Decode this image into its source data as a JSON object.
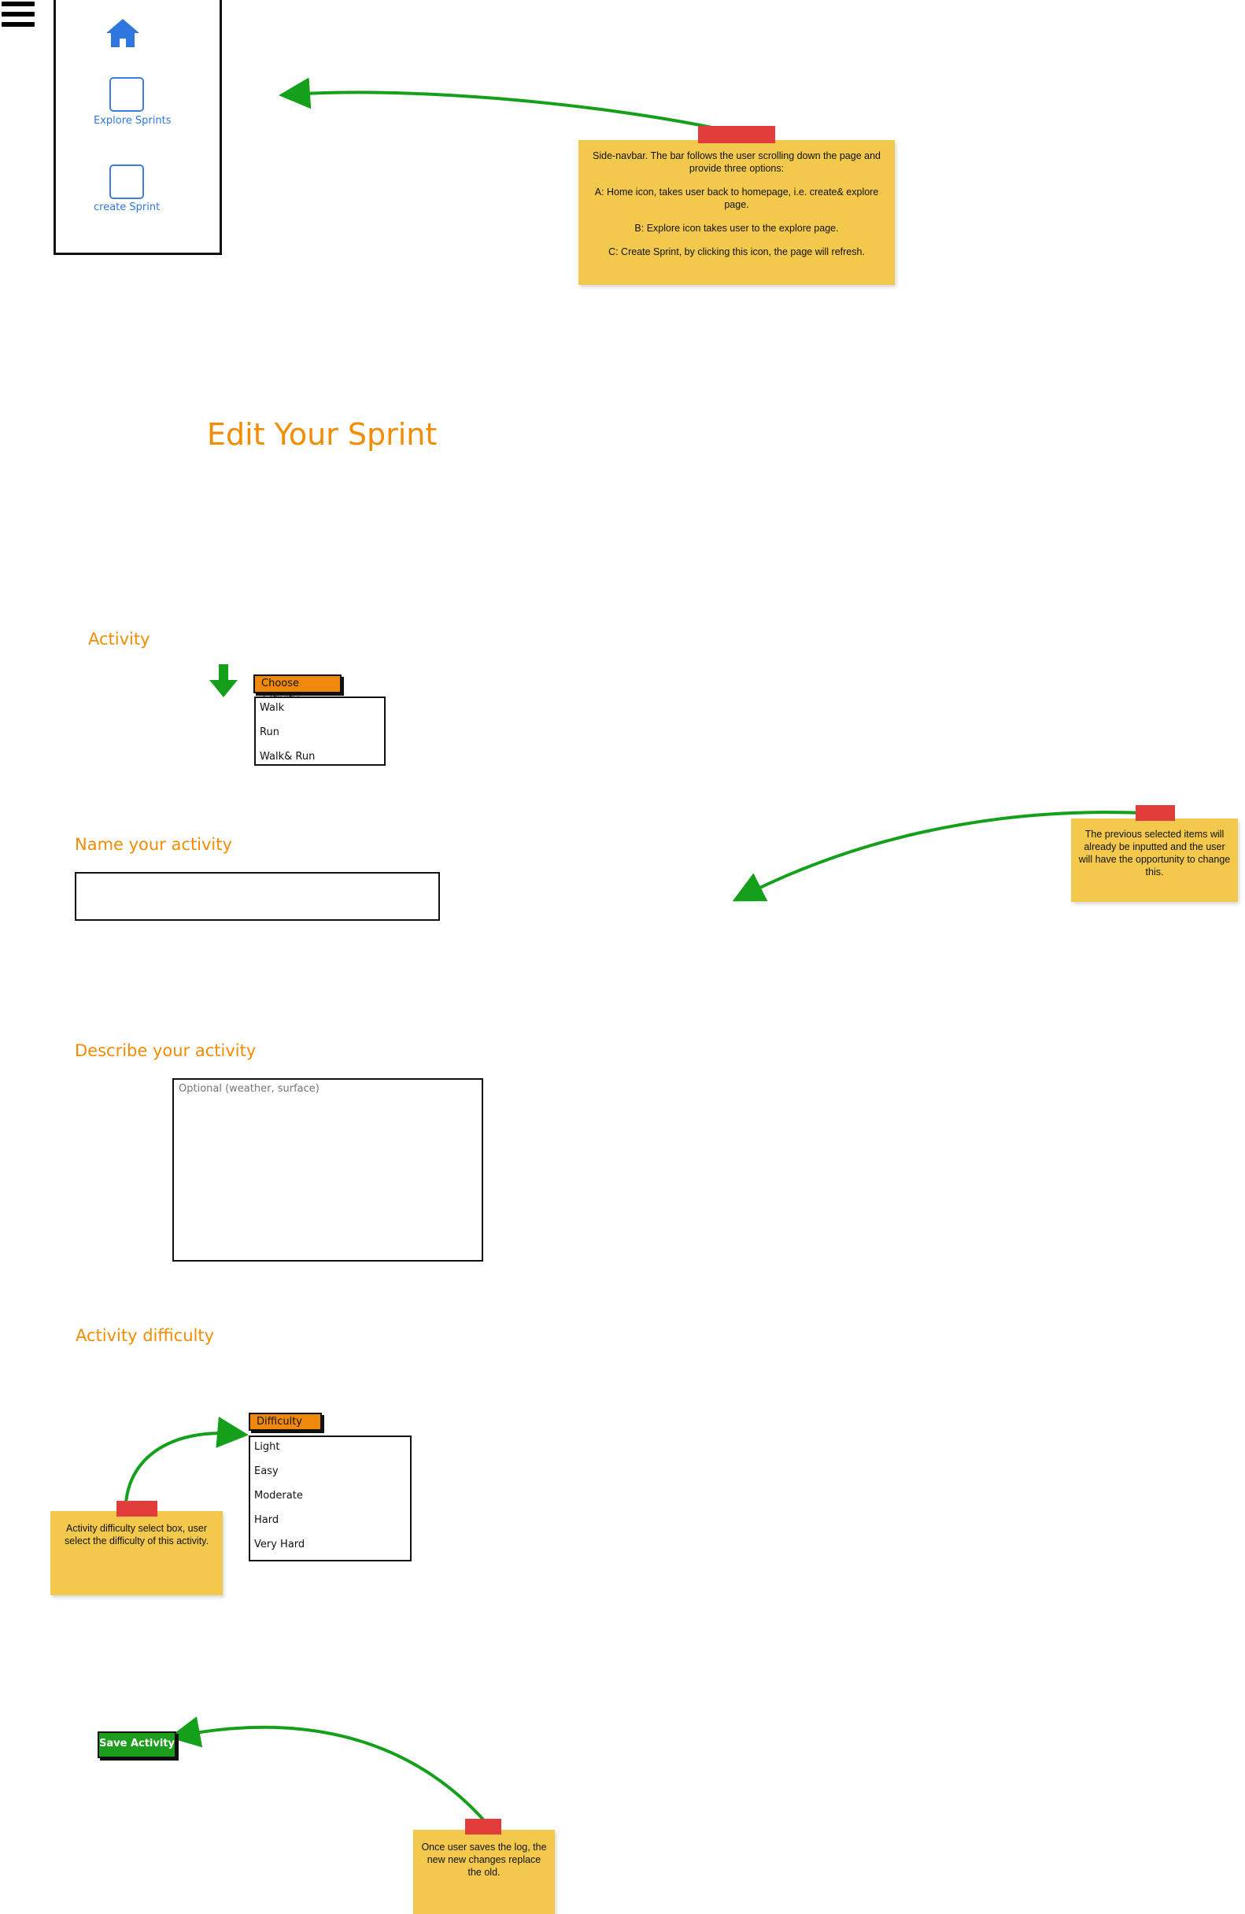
{
  "sidebar": {
    "items": [
      {
        "icon": "home-icon",
        "label": ""
      },
      {
        "icon": "square-icon",
        "label": "Explore Sprints"
      },
      {
        "icon": "square-icon",
        "label": "create Sprint"
      }
    ]
  },
  "notes": {
    "sidebar_note": {
      "line1": "Side-navbar. The bar follows the user scrolling down the page and provide three options:",
      "line2": "A: Home icon, takes user back to homepage, i.e. create& explore page.",
      "line3": "B: Explore icon takes user to the explore page.",
      "line4": "C: Create Sprint, by clicking this icon, the page will refresh."
    },
    "prefill_note": "The previous selected items will already be inputted and the user will have the opportunity to change this.",
    "difficulty_note": "Activity difficulty select box, user select the difficulty of this activity.",
    "save_note": "Once user saves the log, the new new changes replace the old."
  },
  "page": {
    "title": "Edit Your Sprint"
  },
  "activity": {
    "heading": "Activity",
    "dropdown_label": "Choose activity",
    "options": [
      "Walk",
      "Run",
      "Walk& Run"
    ]
  },
  "name_section": {
    "heading": "Name your activity",
    "value": ""
  },
  "describe_section": {
    "heading": "Describe your activity",
    "placeholder": "Optional (weather, surface)"
  },
  "difficulty_section": {
    "heading": "Activity difficulty",
    "dropdown_label": "Difficulty",
    "options": [
      "Light",
      "Easy",
      "Moderate",
      "Hard",
      "Very Hard"
    ]
  },
  "save_button": {
    "label": "Save Activity"
  },
  "colors": {
    "accent_orange": "#f28c00",
    "nav_blue": "#2f77de",
    "sticky_yellow": "#f2c94c",
    "tape_red": "#e23d3b",
    "arrow_green": "#14a01a"
  }
}
